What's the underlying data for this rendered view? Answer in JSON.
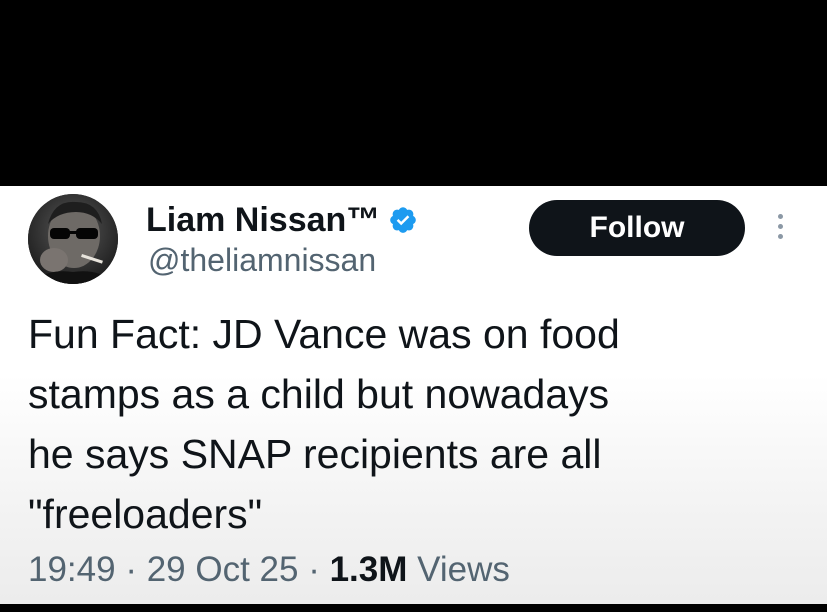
{
  "author": {
    "display_name": "Liam Nissan™",
    "handle": "@theliamnissan",
    "verified": true,
    "avatar_icon": "profile-photo-avatar",
    "verified_icon": "verified-badge-icon"
  },
  "actions": {
    "follow_label": "Follow",
    "more_icon": "more-options-icon"
  },
  "tweet": {
    "text": "Fun Fact: JD Vance was on food\nstamps as a child but nowadays\nhe says SNAP recipients are all\n\"freeloaders\""
  },
  "meta": {
    "time": "19:49",
    "separator_1": " · ",
    "date": "29 Oct 25",
    "separator_2": " · ",
    "views_count": "1.3M",
    "views_label": " Views"
  },
  "colors": {
    "primary_text": "#0f1419",
    "secondary_text": "#536471",
    "verified_blue": "#1d9bf0",
    "follow_button_bg": "#0f1419",
    "follow_button_text": "#ffffff",
    "frame_background": "#000000"
  }
}
